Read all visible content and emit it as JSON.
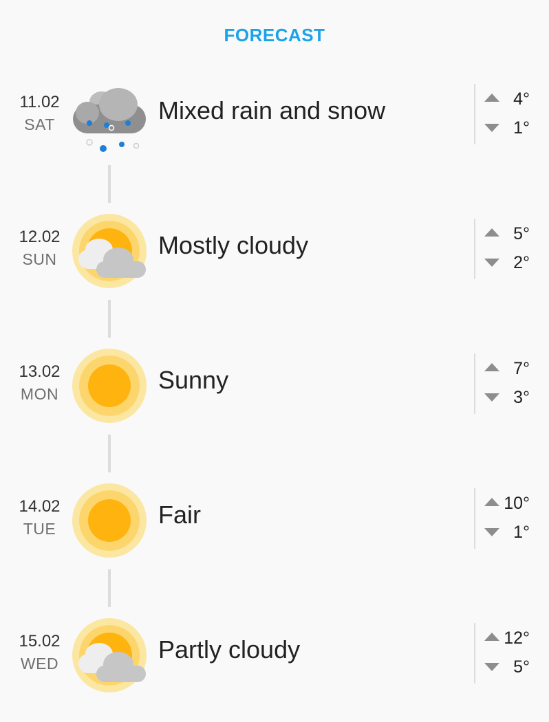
{
  "header": {
    "title": "FORECAST",
    "color": "#1aa3e8"
  },
  "days": [
    {
      "date": "11.02",
      "weekday": "SAT",
      "condition": "Mixed rain and snow",
      "icon": "rain-snow-icon",
      "high": "4°",
      "low": "1°"
    },
    {
      "date": "12.02",
      "weekday": "SUN",
      "condition": "Mostly cloudy",
      "icon": "mostly-cloudy-icon",
      "high": "5°",
      "low": "2°"
    },
    {
      "date": "13.02",
      "weekday": "MON",
      "condition": "Sunny",
      "icon": "sun-icon",
      "high": "7°",
      "low": "3°"
    },
    {
      "date": "14.02",
      "weekday": "TUE",
      "condition": "Fair",
      "icon": "sun-icon",
      "high": "10°",
      "low": "1°"
    },
    {
      "date": "15.02",
      "weekday": "WED",
      "condition": "Partly cloudy",
      "icon": "partly-cloudy-icon",
      "high": "12°",
      "low": "5°"
    }
  ]
}
